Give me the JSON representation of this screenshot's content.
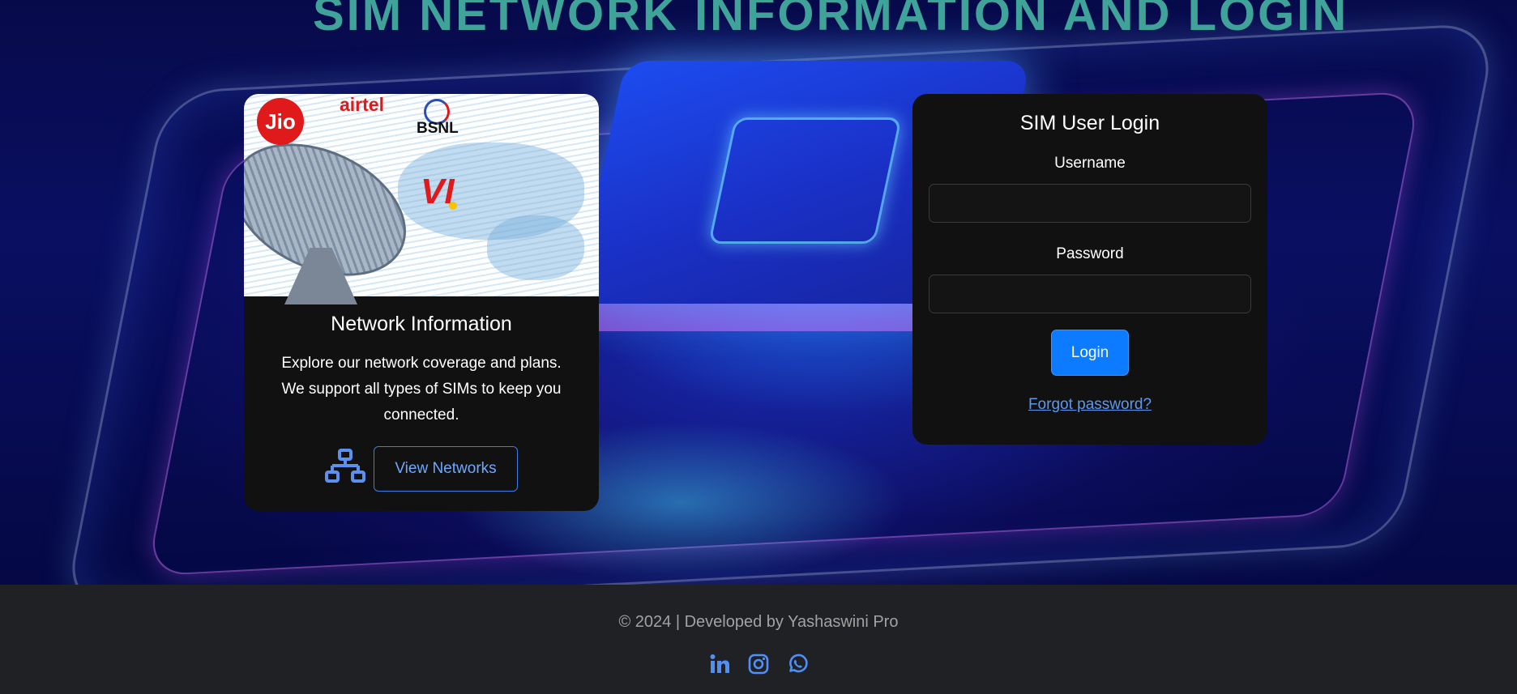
{
  "header": {
    "title": "SIM NETWORK INFORMATION AND LOGIN"
  },
  "network_card": {
    "title": "Network Information",
    "description": "Explore our network coverage and plans. We support all types of SIMs to keep you connected.",
    "button_label": "View Networks",
    "icon": "network-icon",
    "logos": {
      "jio": "Jio",
      "airtel": "airtel",
      "bsnl": "BSNL",
      "vi": "VI"
    }
  },
  "login_card": {
    "title": "SIM User Login",
    "username_label": "Username",
    "username_value": "",
    "password_label": "Password",
    "password_value": "",
    "login_button": "Login",
    "forgot_link": "Forgot password?"
  },
  "footer": {
    "copyright": "© 2024 | Developed by Yashaswini Pro",
    "social_icons": [
      "linkedin-icon",
      "instagram-icon",
      "whatsapp-icon"
    ]
  },
  "colors": {
    "title": "#3fa39a",
    "card_bg": "#111111",
    "primary_button": "#0d7bff",
    "link": "#5c98f2",
    "footer_bg": "#202124"
  }
}
